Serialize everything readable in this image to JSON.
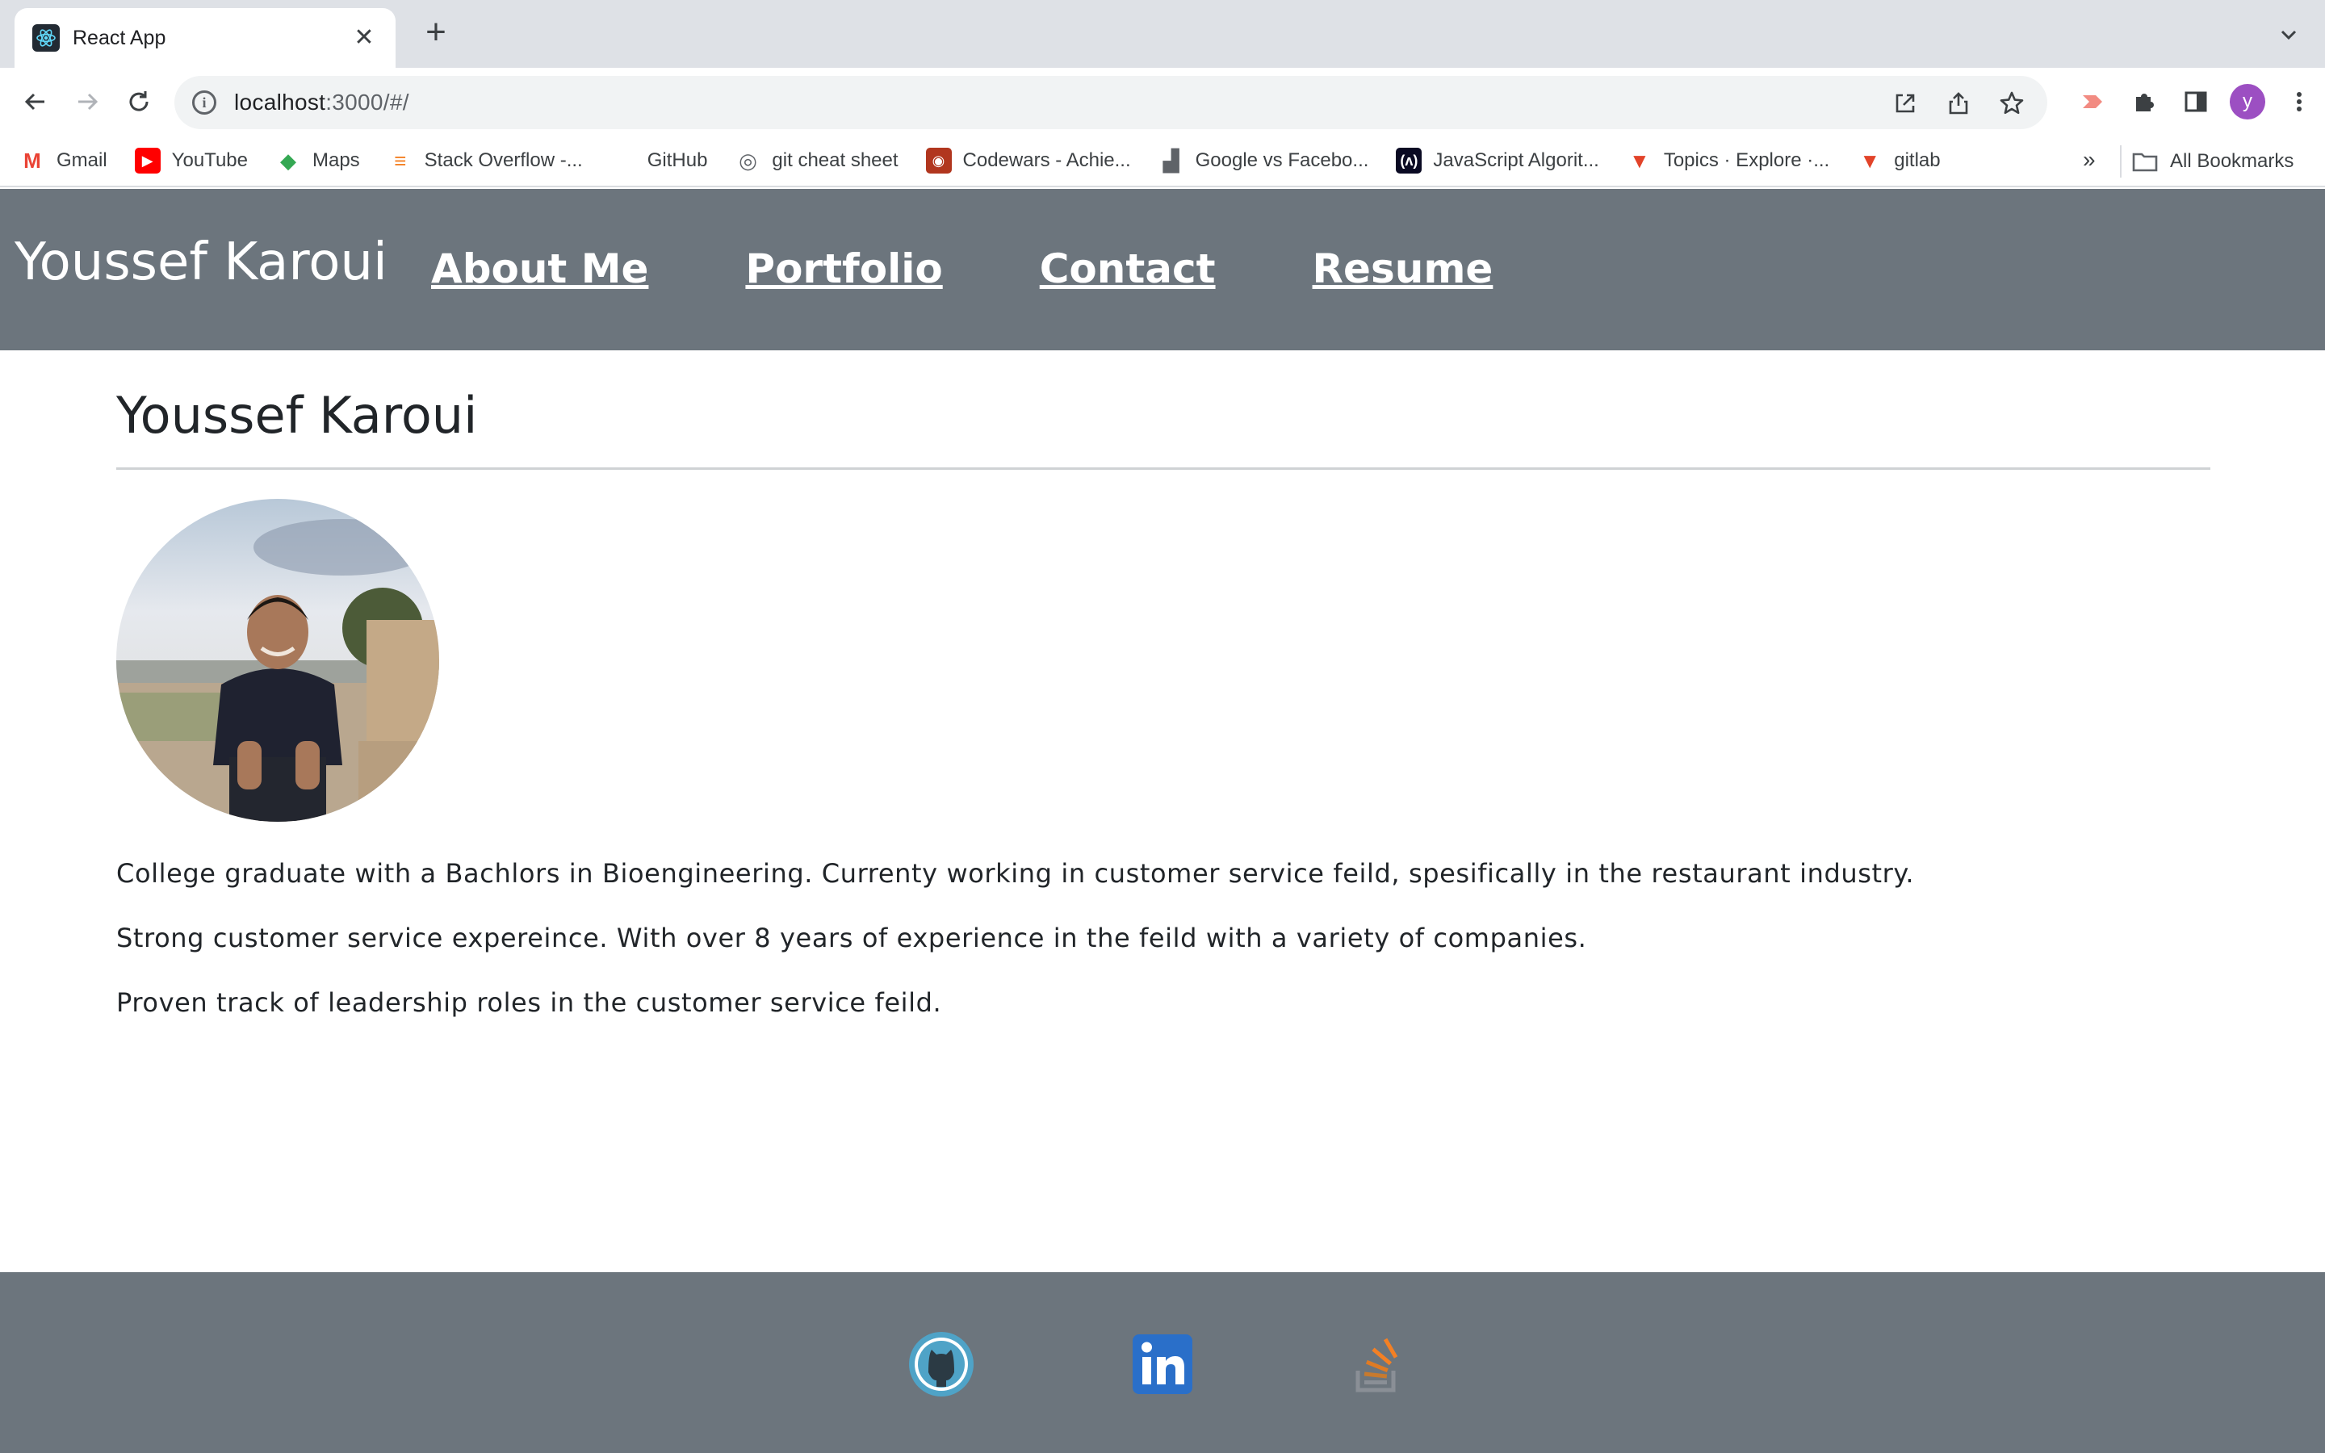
{
  "browser": {
    "tab": {
      "title": "React App",
      "favicon": "react-icon",
      "close_glyph": "✕"
    },
    "new_tab_glyph": "+",
    "url": {
      "host": "localhost",
      "rest": ":3000/#/"
    },
    "avatar_letter": "y",
    "bookmarks": [
      {
        "label": "Gmail",
        "icon": "gmail-icon",
        "color": "#ea4335"
      },
      {
        "label": "YouTube",
        "icon": "youtube-icon",
        "color": "#ff0000"
      },
      {
        "label": "Maps",
        "icon": "maps-icon",
        "color": "#34a853"
      },
      {
        "label": "Stack Overflow -...",
        "icon": "stackoverflow-icon",
        "color": "#f48024"
      },
      {
        "label": "GitHub",
        "icon": "",
        "color": "#ffffff"
      },
      {
        "label": "git cheat sheet",
        "icon": "globe-icon",
        "color": "#5f6368"
      },
      {
        "label": "Codewars - Achie...",
        "icon": "codewars-icon",
        "color": "#b1361e"
      },
      {
        "label": "Google vs Facebo...",
        "icon": "chart-icon",
        "color": "#5f6368"
      },
      {
        "label": "JavaScript Algorit...",
        "icon": "freecodecamp-icon",
        "color": "#0a0a23"
      },
      {
        "label": "Topics · Explore ·...",
        "icon": "gitlab-icon",
        "color": "#e24329"
      },
      {
        "label": "gitlab",
        "icon": "gitlab-icon",
        "color": "#e24329"
      }
    ],
    "bookmarks_overflow": "»",
    "all_bookmarks": "All Bookmarks"
  },
  "site": {
    "brand": "Youssef Karoui",
    "nav": [
      "About Me",
      "Portfolio",
      "Contact",
      "Resume"
    ],
    "page_title": "Youssef Karoui",
    "photo_alt": "profile-photo",
    "bio": [
      "College graduate with a Bachlors in Bioengineering. Currenty working in customer service feild, spesifically in the restaurant industry.",
      "Strong customer service expereince. With over 8 years of experience in the feild with a variety of companies.",
      "Proven track of leadership roles in the customer service feild."
    ],
    "social": [
      {
        "name": "github-icon",
        "color": "#4fa3c7"
      },
      {
        "name": "linkedin-icon",
        "color": "#2a6fc9"
      },
      {
        "name": "stackoverflow-icon",
        "color": "#f48024"
      }
    ]
  },
  "colors": {
    "header_bg": "#6c757d",
    "footer_bg": "#6c757d",
    "tabstrip_bg": "#dee1e6"
  }
}
